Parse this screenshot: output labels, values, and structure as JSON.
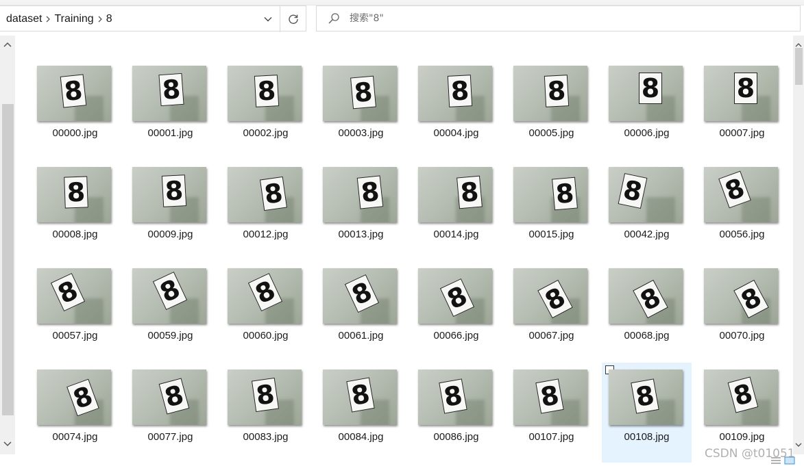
{
  "breadcrumb": {
    "items": [
      "dataset",
      "Training",
      "8"
    ]
  },
  "search": {
    "placeholder": "搜索\"8\""
  },
  "files": [
    [
      "00000.jpg",
      "00001.jpg",
      "00002.jpg",
      "00003.jpg",
      "00004.jpg",
      "00005.jpg",
      "00006.jpg",
      "00007.jpg"
    ],
    [
      "00008.jpg",
      "00009.jpg",
      "00012.jpg",
      "00013.jpg",
      "00014.jpg",
      "00015.jpg",
      "00042.jpg",
      "00056.jpg"
    ],
    [
      "00057.jpg",
      "00059.jpg",
      "00060.jpg",
      "00061.jpg",
      "00066.jpg",
      "00067.jpg",
      "00068.jpg",
      "00070.jpg"
    ],
    [
      "00074.jpg",
      "00077.jpg",
      "00083.jpg",
      "00084.jpg",
      "00086.jpg",
      "00107.jpg",
      "00108.jpg",
      "00109.jpg"
    ]
  ],
  "thumbnail_digit": "8",
  "selected_file": "00108.jpg",
  "watermark": "CSDN @t01051",
  "colors": {
    "selection": "#e5f3ff",
    "border": "#d9d9d9",
    "text": "#1a1a1a"
  }
}
